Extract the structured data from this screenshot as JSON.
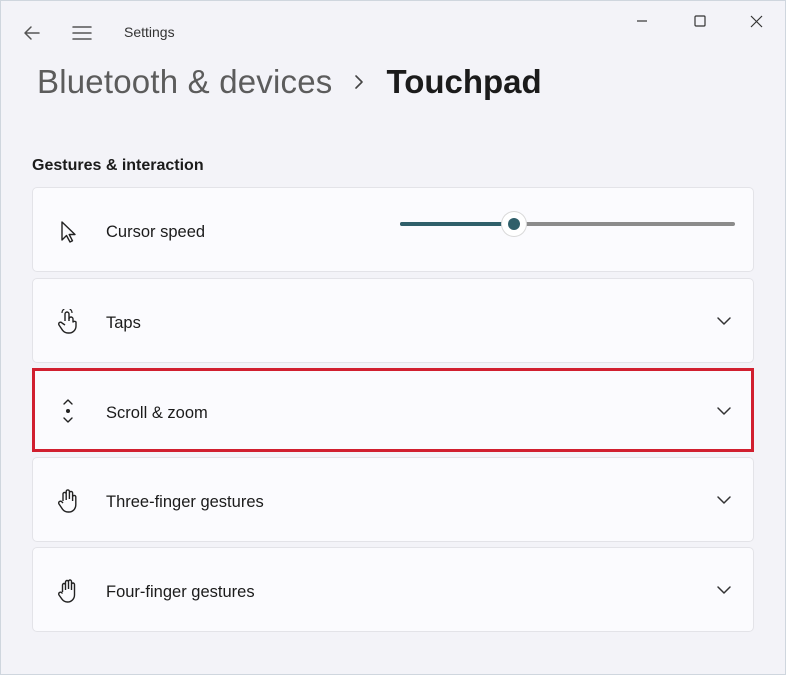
{
  "titlebar": {
    "app_title": "Settings"
  },
  "breadcrumb": {
    "parent": "Bluetooth & devices",
    "current": "Touchpad"
  },
  "section": {
    "title": "Gestures & interaction"
  },
  "settings": {
    "cursor_speed": {
      "label": "Cursor speed",
      "value_fraction": 0.34
    },
    "taps": {
      "label": "Taps"
    },
    "scroll_zoom": {
      "label": "Scroll & zoom"
    },
    "three_finger": {
      "label": "Three-finger gestures"
    },
    "four_finger": {
      "label": "Four-finger gestures"
    }
  },
  "colors": {
    "accent": "#2f5f6a",
    "highlight": "#d11f2f",
    "card_bg": "#fbfbfe",
    "window_bg": "#f3f3f8"
  },
  "icons": {
    "back": "back-arrow-icon",
    "menu": "hamburger-menu-icon",
    "minimize": "minimize-icon",
    "maximize": "maximize-icon",
    "close": "close-icon",
    "cursor": "mouse-pointer-icon",
    "taps": "tap-hand-icon",
    "scroll": "scroll-arrows-icon",
    "three_finger": "hand-icon",
    "four_finger": "hand-icon",
    "chevron": "chevron-down-icon"
  }
}
